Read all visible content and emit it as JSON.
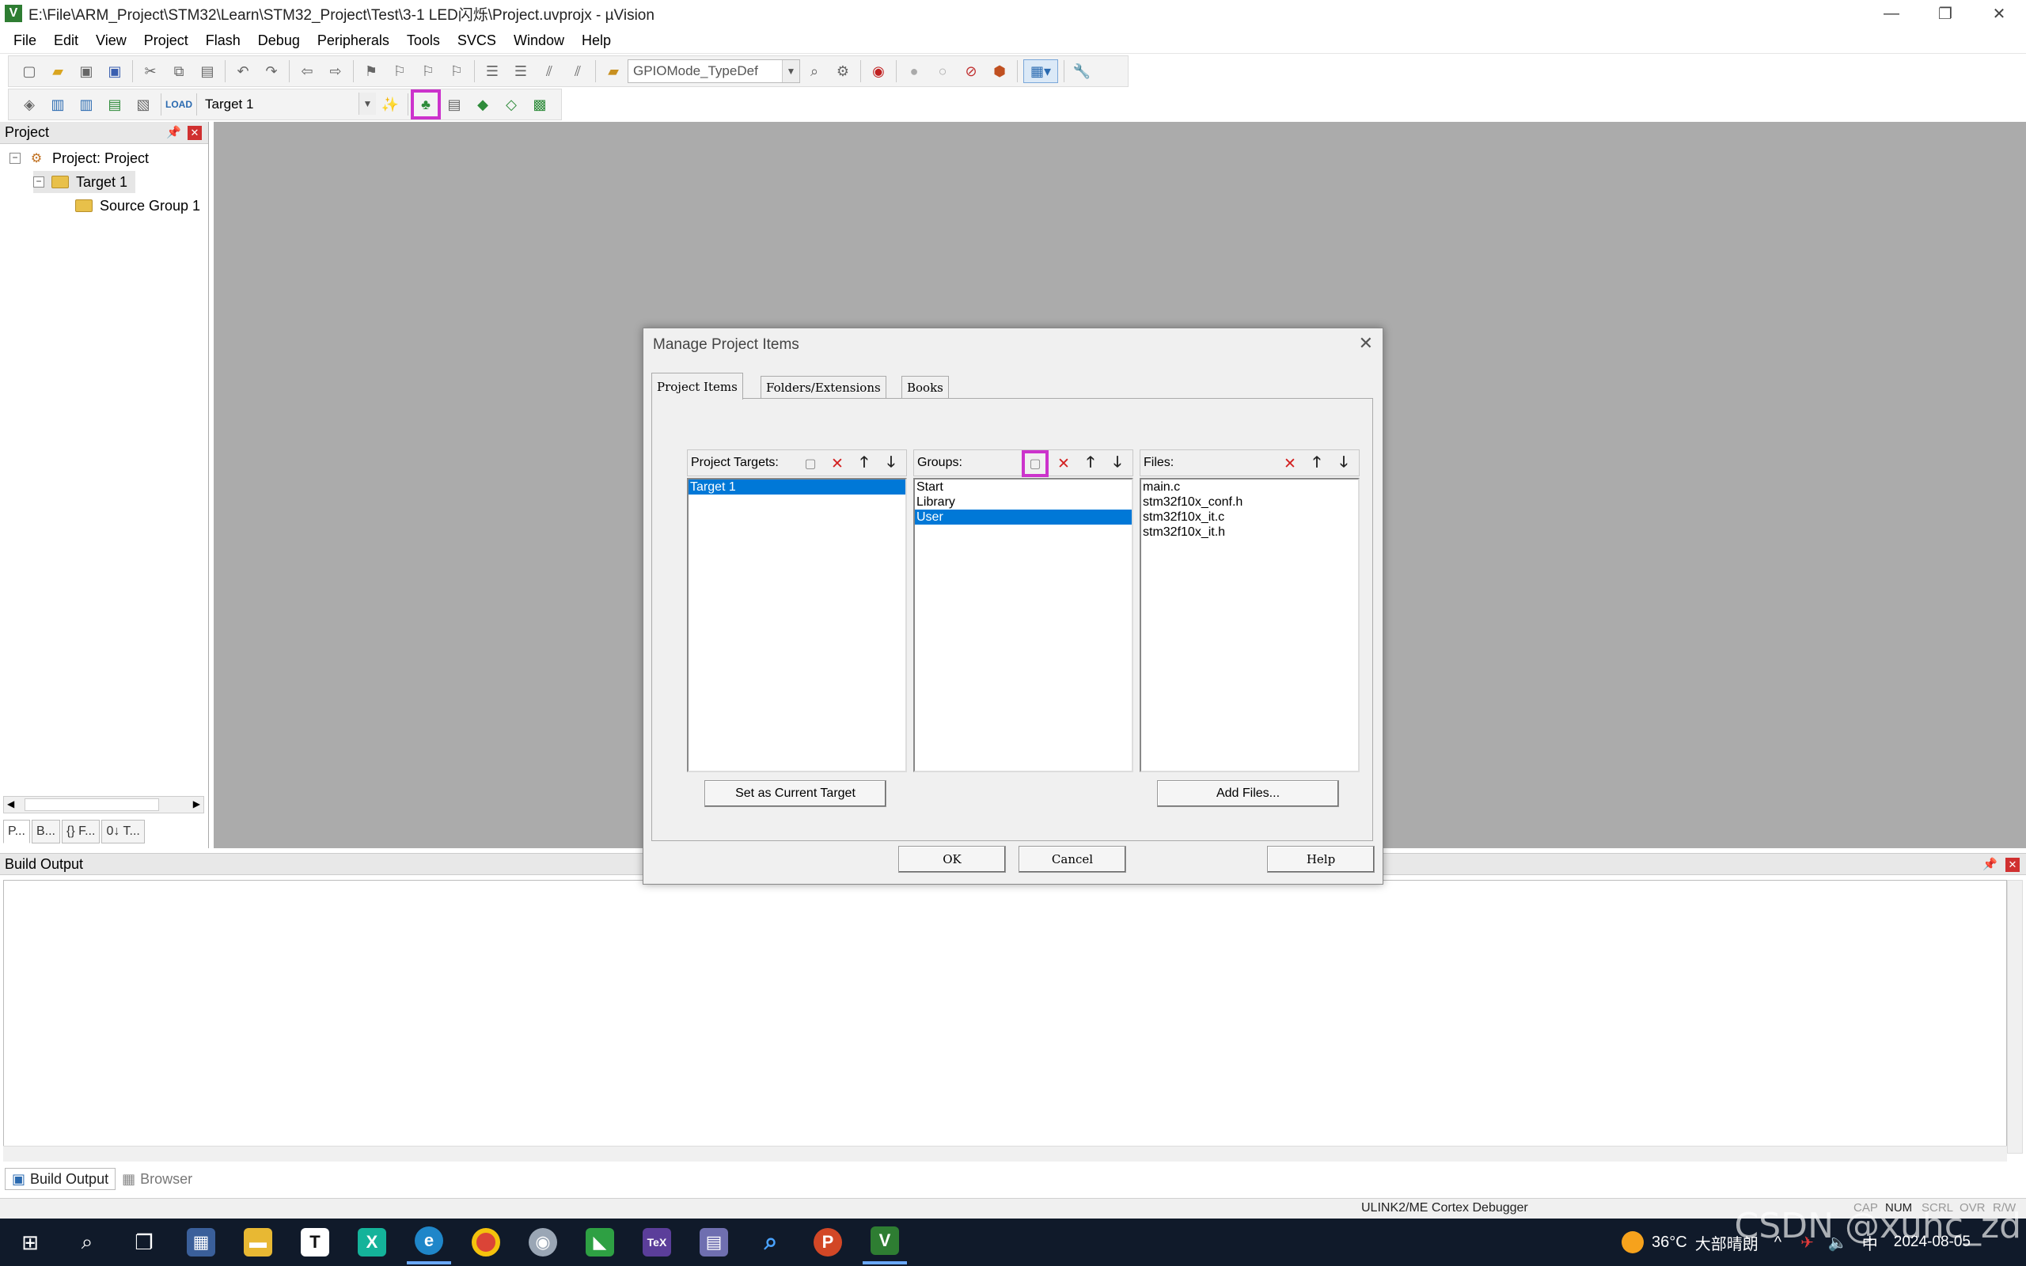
{
  "window": {
    "title": "E:\\File\\ARM_Project\\STM32\\Learn\\STM32_Project\\Test\\3-1 LED闪烁\\Project.uvprojx - µVision",
    "minimize": "—",
    "restore": "❐",
    "close": "✕"
  },
  "menu": [
    "File",
    "Edit",
    "View",
    "Project",
    "Flash",
    "Debug",
    "Peripherals",
    "Tools",
    "SVCS",
    "Window",
    "Help"
  ],
  "toolbar": {
    "find_combo": "GPIOMode_TypeDef",
    "target_combo": "Target 1"
  },
  "project_pane": {
    "title": "Project",
    "tree": {
      "root": "Project: Project",
      "target": "Target 1",
      "group": "Source Group 1"
    },
    "tabs": [
      "P...",
      "B...",
      "{} F...",
      "0↓ T..."
    ]
  },
  "dialog": {
    "title": "Manage Project Items",
    "tabs": [
      "Project Items",
      "Folders/Extensions",
      "Books"
    ],
    "targets_label": "Project Targets:",
    "targets": [
      "Target 1"
    ],
    "groups_label": "Groups:",
    "groups": [
      "Start",
      "Library",
      "User"
    ],
    "files_label": "Files:",
    "files": [
      "main.c",
      "stm32f10x_conf.h",
      "stm32f10x_it.c",
      "stm32f10x_it.h"
    ],
    "set_current_target": "Set as Current Target",
    "add_files": "Add Files...",
    "ok": "OK",
    "cancel": "Cancel",
    "help": "Help"
  },
  "build_output": {
    "title": "Build Output",
    "tabs": [
      "Build Output",
      "Browser"
    ]
  },
  "statusbar": {
    "debugger": "ULINK2/ME Cortex Debugger",
    "indicators": [
      "CAP",
      "NUM",
      "SCRL",
      "OVR",
      "R/W"
    ]
  },
  "taskbar": {
    "weather_temp": "36°C",
    "weather_text": "大部晴朗",
    "ime": "中",
    "time": "",
    "date": "2024-08-05"
  },
  "watermark": "CSDN @xuhc_zd",
  "colors": {
    "selection": "#0078d7",
    "highlight_outline": "#cc33cc",
    "workspace_bg": "#ababab",
    "taskbar_bg": "#101a2a"
  }
}
